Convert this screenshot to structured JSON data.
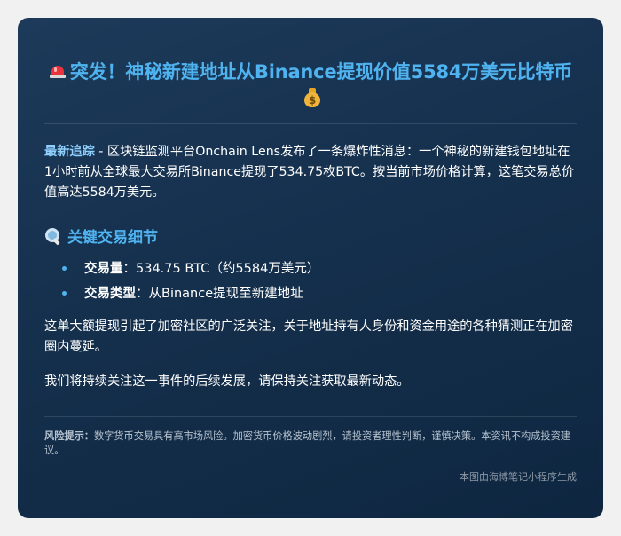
{
  "article": {
    "title": "突发！神秘新建地址从Binance提现价值5584万美元比特币",
    "title_icons": [
      "rotating-light-icon",
      "money-bag-icon"
    ],
    "intro_lead": "最新追踪",
    "intro_text": " - 区块链监测平台Onchain Lens发布了一条爆炸性消息：一个神秘的新建钱包地址在1小时前从全球最大交易所Binance提现了534.75枚BTC。按当前市场价格计算，这笔交易总价值高达5584万美元。",
    "section_title": "关键交易细节",
    "section_icon": "magnifying-glass-icon",
    "details": [
      {
        "label": "交易量",
        "sep": "：",
        "value": "534.75 BTC（约5584万美元）"
      },
      {
        "label": "交易类型",
        "sep": "：",
        "value": "从Binance提现至新建地址"
      }
    ],
    "paragraph1": "这单大额提现引起了加密社区的广泛关注，关于地址持有人身份和资金用途的各种猜测正在加密圈内蔓延。",
    "paragraph2": "我们将持续关注这一事件的后续发展，请保持关注获取最新动态。",
    "risk_label": "风险提示：",
    "risk_text": "数字货币交易具有高市场风险。加密货币价格波动剧烈，请投资者理性判断，谨慎决策。本资讯不构成投资建议。",
    "footer": "本图由海博笔记小程序生成"
  },
  "colors": {
    "accent": "#4fb3f0",
    "lead": "#8fd0ff",
    "card_top": "#1d3a5a",
    "card_bottom": "#0e2640",
    "muted": "#b7c3cf",
    "footer": "#8e9aa6"
  }
}
